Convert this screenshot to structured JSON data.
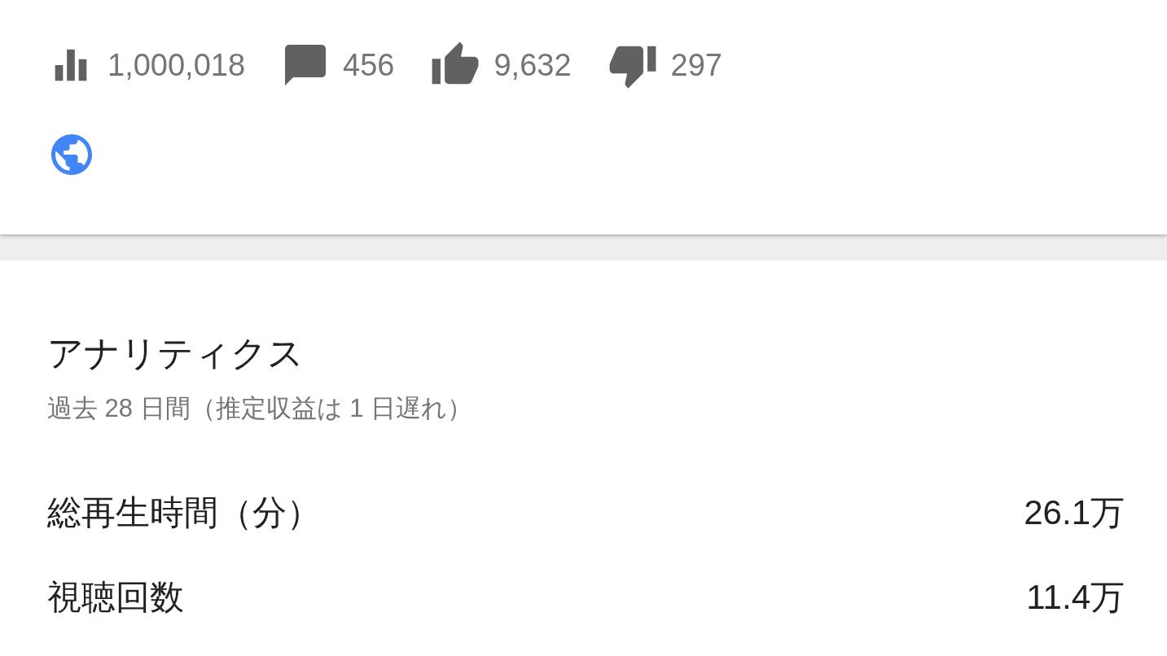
{
  "stats": [
    {
      "kind": "views",
      "value": "1,000,018"
    },
    {
      "kind": "comments",
      "value": "456"
    },
    {
      "kind": "likes",
      "value": "9,632"
    },
    {
      "kind": "dislikes",
      "value": "297"
    }
  ],
  "analytics": {
    "title": "アナリティクス",
    "subtitle": "過去 28 日間（推定収益は 1 日遅れ）",
    "metrics": [
      {
        "label": "総再生時間（分）",
        "value": "26.1万"
      },
      {
        "label": "視聴回数",
        "value": "11.4万"
      }
    ]
  }
}
